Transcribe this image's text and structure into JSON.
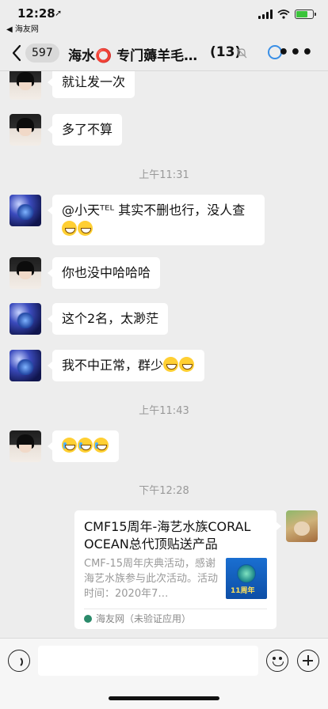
{
  "status": {
    "time": "12:28",
    "back_app": "◀ 海友网",
    "battery_percent": 70,
    "battery_color": "#3bc43b"
  },
  "nav": {
    "back_count": "597",
    "title": "海水⭕ 专门薅羊毛…",
    "member_count": "(13)",
    "circle_color": "#3a8fe6",
    "more_icon": "more-dots"
  },
  "messages": [
    {
      "side": "left",
      "avatar": "boy",
      "text": "就让发一次"
    },
    {
      "side": "left",
      "avatar": "boy",
      "text": "多了不算"
    },
    {
      "type": "time",
      "text": "上午11:31"
    },
    {
      "side": "left",
      "avatar": "blue",
      "text": "@小天ᵀᴱᴸ 其实不删也行，没人查",
      "emoji_count": 2,
      "emoji": "grin"
    },
    {
      "side": "left",
      "avatar": "boy",
      "text": "你也没中哈哈哈"
    },
    {
      "side": "left",
      "avatar": "blue",
      "text": "这个2名，太渺茫"
    },
    {
      "side": "left",
      "avatar": "blue",
      "text": "我不中正常，群少",
      "emoji_count": 2,
      "emoji": "grin"
    },
    {
      "type": "time",
      "text": "上午11:43"
    },
    {
      "side": "left",
      "avatar": "boy",
      "text": "",
      "emoji_count": 3,
      "emoji": "laugh-cry"
    },
    {
      "type": "time",
      "text": "下午12:28"
    }
  ],
  "link_card": {
    "title": "CMF15周年-海艺水族CORAL OCEAN总代顶贴送产品",
    "description": "CMF-15周年庆典活动，感谢海艺水族参与此次活动。活动时间：2020年7…",
    "source": "海友网（未验证应用）",
    "thumb_label": "11周年"
  },
  "input": {
    "placeholder": ""
  }
}
